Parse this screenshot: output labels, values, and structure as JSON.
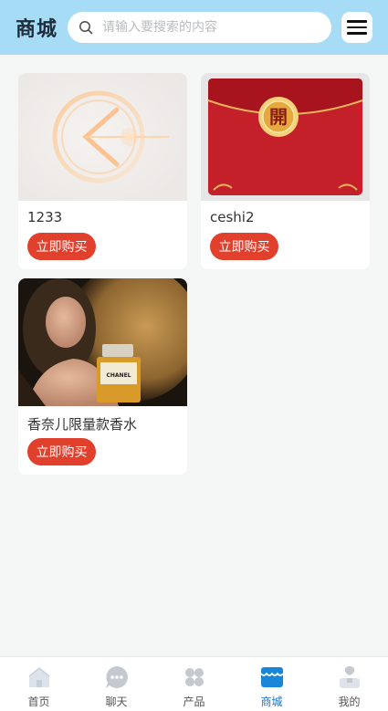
{
  "header": {
    "title": "商城",
    "search_placeholder": "请输入要搜索的内容"
  },
  "products": [
    {
      "name": "1233",
      "buy_label": "立即购买"
    },
    {
      "name": "ceshi2",
      "buy_label": "立即购买",
      "image_text": "開"
    },
    {
      "name": "香奈儿限量款香水",
      "buy_label": "立即购买",
      "image_text": "CHANEL"
    }
  ],
  "tabbar": {
    "items": [
      {
        "label": "首页",
        "icon": "home-icon"
      },
      {
        "label": "聊天",
        "icon": "chat-icon"
      },
      {
        "label": "产品",
        "icon": "products-icon"
      },
      {
        "label": "商城",
        "icon": "shop-icon",
        "active": true
      },
      {
        "label": "我的",
        "icon": "profile-icon"
      }
    ]
  },
  "colors": {
    "header_bg": "#a6dcf6",
    "buy_button": "#e0402c",
    "active_tab": "#1a73d9"
  }
}
